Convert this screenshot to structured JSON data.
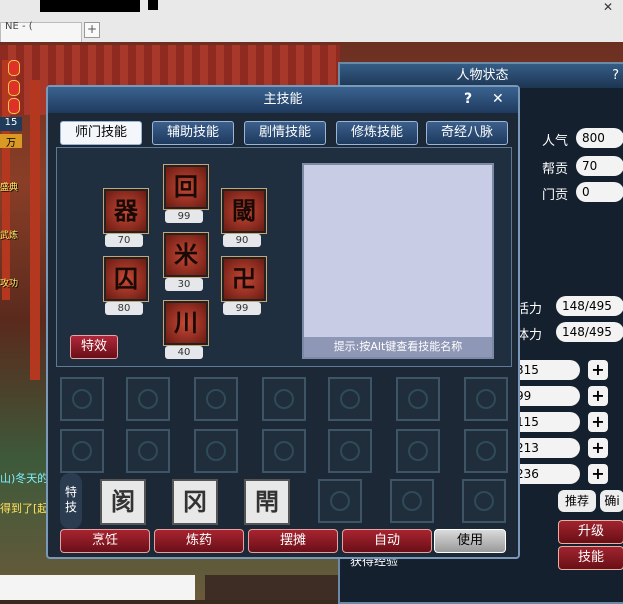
{
  "browser": {
    "tab_text": "NE - (",
    "new_tab": "+",
    "close_label": "✕"
  },
  "hud_left": {
    "level_badge": "15",
    "gold_badge": "万",
    "labels": [
      "盛典",
      "武炼",
      "攻功"
    ]
  },
  "chat": {
    "line1": "山)冬天的",
    "line2": "得到了[起"
  },
  "character_window": {
    "title": "人物状态",
    "help": "?",
    "stats": [
      {
        "label": "人气",
        "value": "800"
      },
      {
        "label": "帮贡",
        "value": "70"
      },
      {
        "label": "门贡",
        "value": "0"
      }
    ],
    "energy": [
      {
        "label": "活力",
        "value": "148/495"
      },
      {
        "label": "体力",
        "value": "148/495"
      }
    ],
    "attributes": [
      "315",
      "99",
      "115",
      "213",
      "236"
    ],
    "plus_label": "+",
    "recommend_label": "推荐",
    "confirm_label": "确i",
    "upgrade_label": "升级",
    "skill_label": "技能",
    "exp_label": "获得经验"
  },
  "skill_window": {
    "title": "主技能",
    "help": "?",
    "close": "✕",
    "tabs": [
      "师门技能",
      "辅助技能",
      "剧情技能",
      "修炼技能",
      "奇经八脉"
    ],
    "active_tab": 0,
    "skills": [
      {
        "glyph": "回",
        "level": "99"
      },
      {
        "glyph": "器",
        "level": "70"
      },
      {
        "glyph": "閾",
        "level": "90"
      },
      {
        "glyph": "米",
        "level": "30"
      },
      {
        "glyph": "囚",
        "level": "80"
      },
      {
        "glyph": "卍",
        "level": "99"
      },
      {
        "glyph": "川",
        "level": "40"
      }
    ],
    "effects_button": "特效",
    "hint": "提示:按Alt键查看技能名称",
    "special_label": "特技",
    "special_skills": [
      "阂",
      "冈",
      "閈"
    ],
    "bottom_buttons": [
      "烹饪",
      "炼药",
      "摆摊",
      "自动",
      "使用"
    ]
  },
  "colors": {
    "accent": "#a82430",
    "window": "#1c2836",
    "title": "#2a4a73"
  }
}
